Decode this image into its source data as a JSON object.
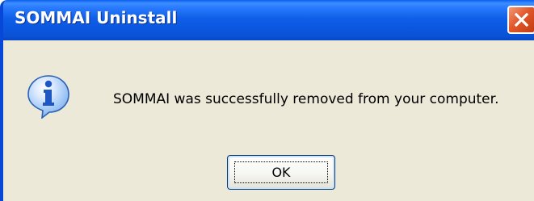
{
  "window": {
    "title": "SOMMAI Uninstall",
    "close_icon": "close-icon"
  },
  "dialog": {
    "icon": "info-icon",
    "message": "SOMMAI was successfully removed from your computer.",
    "ok_label": "OK"
  },
  "colors": {
    "titlebar": "#0b57e0",
    "body": "#ece9d8",
    "close_button": "#e2582b",
    "info_icon": "#1e6fd9"
  }
}
